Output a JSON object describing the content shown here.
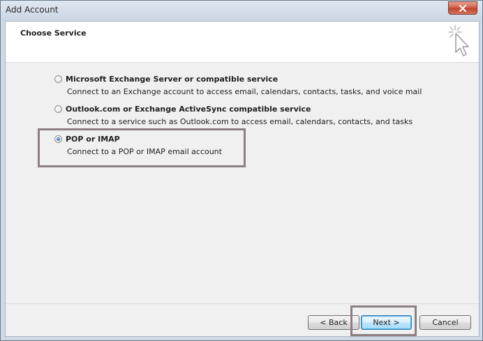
{
  "window": {
    "title": "Add Account"
  },
  "header": {
    "title": "Choose Service",
    "icon": "cursor-sparkle-icon"
  },
  "options": [
    {
      "label": "Microsoft Exchange Server or compatible service",
      "description": "Connect to an Exchange account to access email, calendars, contacts, tasks, and voice mail",
      "selected": false
    },
    {
      "label": "Outlook.com or Exchange ActiveSync compatible service",
      "description": "Connect to a service such as Outlook.com to access email, calendars, contacts, and tasks",
      "selected": false
    },
    {
      "label": "POP or IMAP",
      "description": "Connect to a POP or IMAP email account",
      "selected": true
    }
  ],
  "buttons": {
    "back": "< Back",
    "next": "Next >",
    "cancel": "Cancel"
  },
  "colors": {
    "highlight": "#8c7f84",
    "default_button_border": "#3c7fb1",
    "close_button": "#c1422b"
  }
}
